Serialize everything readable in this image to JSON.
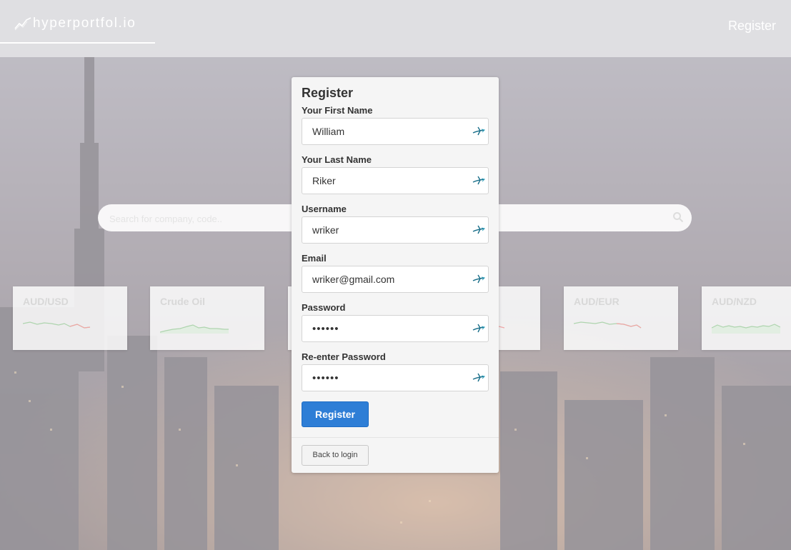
{
  "navbar": {
    "brand": "hyperportfol.io",
    "brand_icon": "trend-line-icon",
    "register_link": "Register"
  },
  "search": {
    "placeholder": "Search for company, code..",
    "icon": "search-icon"
  },
  "tickers": [
    {
      "name": "AUD/USD",
      "trend": "mixed"
    },
    {
      "name": "Crude Oil",
      "trend": "up"
    },
    {
      "name": "",
      "trend": "hidden"
    },
    {
      "name": "",
      "trend": "hidden"
    },
    {
      "name": "AUD/EUR",
      "trend": "mixed"
    },
    {
      "name": "AUD/NZD",
      "trend": "up"
    }
  ],
  "form": {
    "title": "Register",
    "fields": [
      {
        "label": "Your First Name",
        "value": "William",
        "type": "text"
      },
      {
        "label": "Your Last Name",
        "value": "Riker",
        "type": "text"
      },
      {
        "label": "Username",
        "value": "wriker",
        "type": "text"
      },
      {
        "label": "Email",
        "value": "wriker@gmail.com",
        "type": "email"
      },
      {
        "label": "Password",
        "value": "••••••",
        "type": "password"
      },
      {
        "label": "Re-enter Password",
        "value": "••••••",
        "type": "password"
      }
    ],
    "field_icon": "autofill-key-icon",
    "submit_label": "Register",
    "back_label": "Back to login"
  },
  "colors": {
    "primary_button": "#2e7ed6",
    "chart_up": "#4caf50",
    "chart_down": "#e53935",
    "field_icon": "#1a6f8a"
  }
}
